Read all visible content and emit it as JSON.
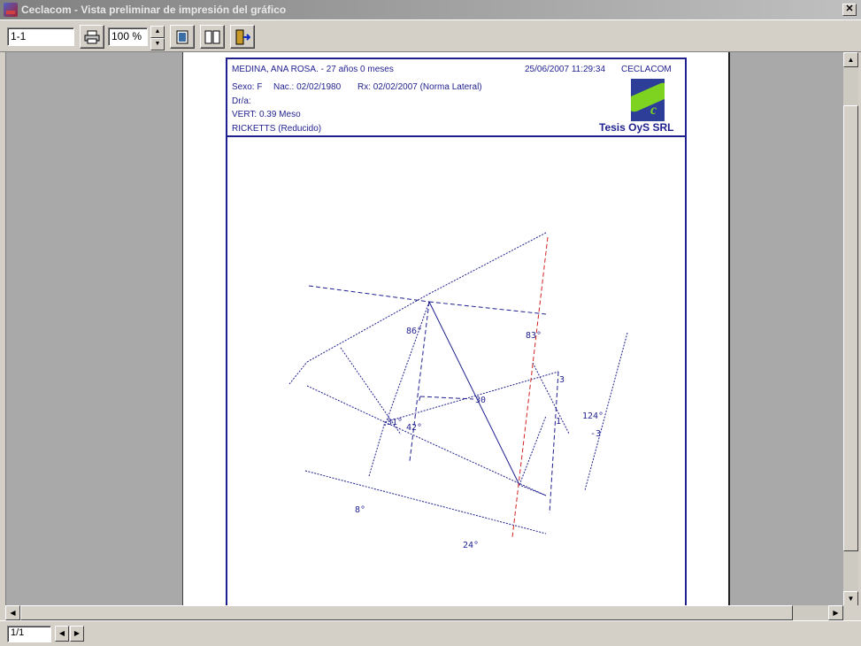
{
  "window": {
    "title": "Ceclacom - Vista preliminar de impresión del gráfico",
    "close": "✕"
  },
  "toolbar": {
    "page_range": "1-1",
    "zoom": "100 %"
  },
  "report": {
    "patient": "MEDINA, ANA ROSA. - 27 años 0 meses",
    "datetime": "25/06/2007 11:29:34",
    "org": "CECLACOM",
    "sex": "Sexo: F",
    "birth": "Nac.: 02/02/1980",
    "rx": "Rx: 02/02/2007 (Norma Lateral)",
    "doctor": "Dr/a:",
    "vert": "VERT: 0.39 Meso",
    "analysis": "RICKETTS (Reducido)",
    "brand": "Tesis OyS SRL",
    "logo_letter": "c"
  },
  "tracing": {
    "labels": {
      "a86": "86°",
      "a83": "83°",
      "a3": "3",
      "a30": "30",
      "a31": "31°",
      "a42": "42°",
      "a1": "1",
      "a124": "124°",
      "am3": "-3",
      "a8": "8°",
      "a24": "24°"
    }
  },
  "statusbar": {
    "page_of": "1/1"
  },
  "colors": {
    "ink": "#1f1f8f",
    "red_line": "#d02020",
    "workspace": "#a9a9a9"
  }
}
